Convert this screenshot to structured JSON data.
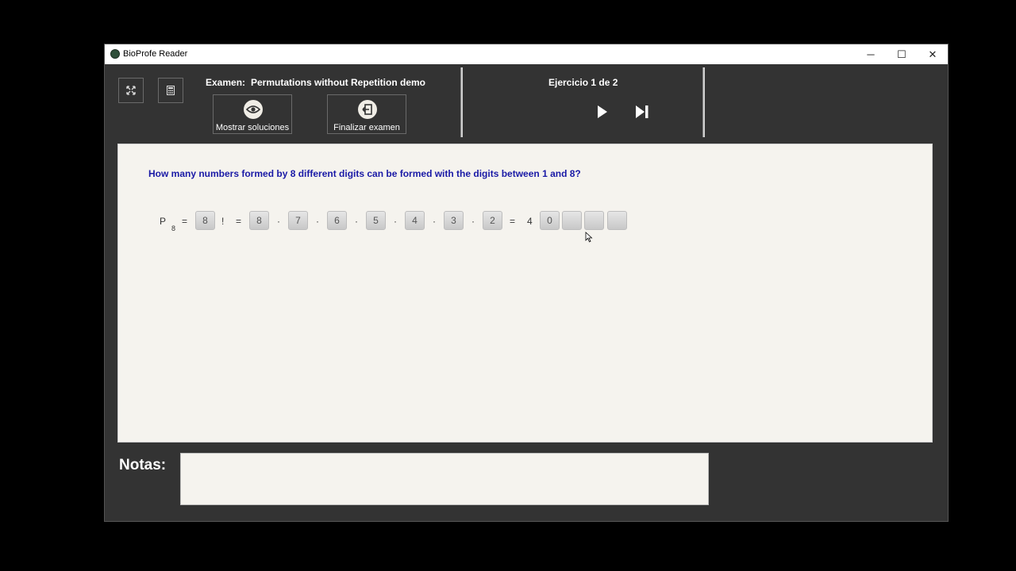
{
  "window": {
    "title": "BioProfe Reader",
    "controls": {
      "minimize": "─",
      "maximize": "☐",
      "close": "✕"
    }
  },
  "toolbar": {
    "fullscreen_icon": "expand-icon",
    "calculator_icon": "calculator-icon",
    "exam_label": "Examen:",
    "exam_name": "Permutations without Repetition demo",
    "show_solutions_label": "Mostrar soluciones",
    "finish_exam_label": "Finalizar examen",
    "exercise_counter": "Ejercicio 1 de 2"
  },
  "exercise": {
    "question": "How many numbers formed by 8 different digits can be formed with the digits between 1 and 8?",
    "formula": {
      "p": "P",
      "p_sub": "8",
      "eq1": "=",
      "n_box": "8",
      "factorial": "!",
      "eq2": "=",
      "factors": [
        "8",
        "7",
        "6",
        "5",
        "4",
        "3",
        "2"
      ],
      "dots": [
        "·",
        "·",
        "·",
        "·",
        "·",
        "·"
      ],
      "eq3": "=",
      "result_prefix": "4",
      "result_boxes": [
        "0",
        "",
        "",
        ""
      ]
    }
  },
  "notes": {
    "label": "Notas:",
    "value": ""
  },
  "colors": {
    "background": "#333333",
    "content": "#f5f3ee",
    "question": "#1a1aa6"
  }
}
